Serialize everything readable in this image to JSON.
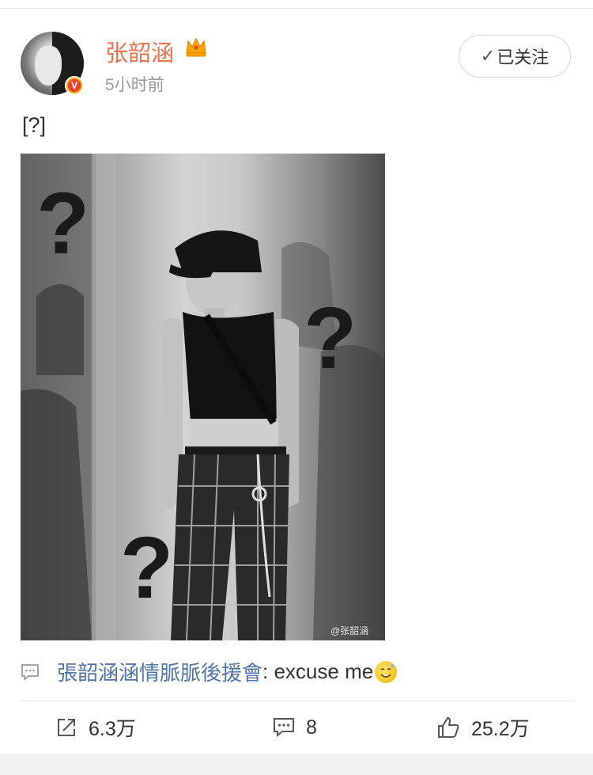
{
  "post": {
    "author": {
      "name": "张韶涵",
      "timestamp": "5小时前",
      "avatar_icon": "avatar",
      "verified_icon": "verified-badge-icon",
      "verified_text": "V",
      "crown_icon": "crown-icon"
    },
    "follow_button": {
      "label": "已关注",
      "icon": "check-icon"
    },
    "text": "[?]",
    "image": {
      "question_marks": [
        "?",
        "?",
        "?"
      ],
      "watermark": "@张韶涵"
    },
    "repost": {
      "icon": "comment-icon",
      "user": "張韶涵涵情脈脈後援會",
      "text": ": excuse me",
      "emoji": "sweat-smile-emoji"
    },
    "actions": {
      "share": {
        "icon": "share-icon",
        "count": "6.3万"
      },
      "comment": {
        "icon": "comment-icon",
        "count": "8"
      },
      "like": {
        "icon": "thumbs-up-icon",
        "count": "25.2万"
      }
    }
  },
  "colors": {
    "username": "#eb7350",
    "link": "#5073a8",
    "muted": "#999999",
    "crown": "#f7a400",
    "verified": "#e8412c"
  }
}
